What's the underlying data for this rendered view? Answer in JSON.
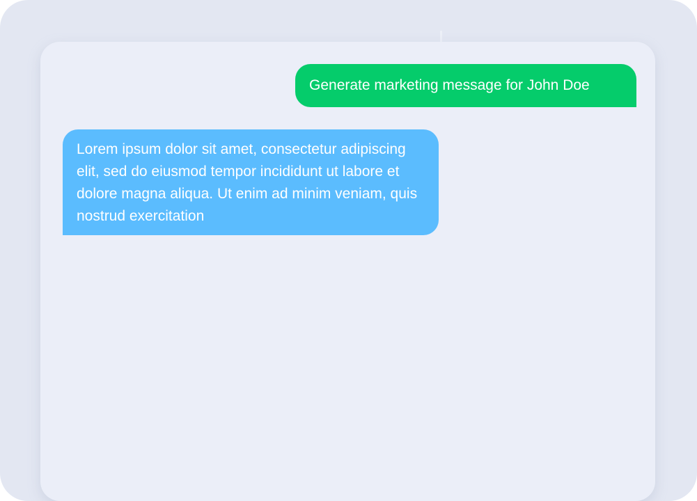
{
  "colors": {
    "outer_background": "#e3e7f2",
    "panel_background": "#ebeef8",
    "user_bubble": "#05cc6b",
    "assistant_bubble": "#5bbcfe",
    "bubble_text": "#ffffff"
  },
  "conversation": {
    "messages": [
      {
        "role": "user",
        "text": "Generate marketing message for John Doe"
      },
      {
        "role": "assistant",
        "text": "Lorem ipsum dolor sit amet, consectetur adipiscing elit, sed do eiusmod tempor incididunt ut labore et dolore magna aliqua. Ut enim ad minim veniam, quis nostrud exercitation"
      }
    ]
  }
}
